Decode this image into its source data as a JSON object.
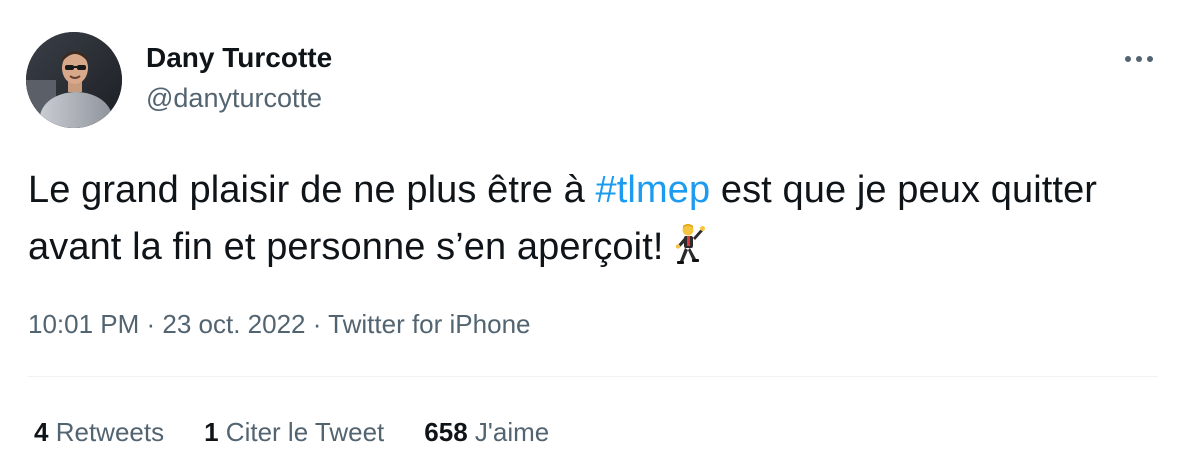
{
  "author": {
    "display_name": "Dany Turcotte",
    "handle": "@danyturcotte"
  },
  "tweet": {
    "text_before": "Le grand plaisir de ne plus être à ",
    "hashtag": "#tlmep",
    "text_after": " est que je peux quitter avant la fin et personne s’en aperçoit!",
    "emoji_icon": "man-dancing-icon"
  },
  "meta": {
    "time": "10:01 PM",
    "separator": " · ",
    "date": "23 oct. 2022",
    "source": "Twitter for iPhone"
  },
  "stats": {
    "retweets_count": "4",
    "retweets_label": "Retweets",
    "quotes_count": "1",
    "quotes_label": "Citer le Tweet",
    "likes_count": "658",
    "likes_label": "J'aime"
  },
  "colors": {
    "text": "#0f1419",
    "secondary": "#536471",
    "accent": "#1d9bf0",
    "divider": "#eff3f4"
  },
  "icons": {
    "more": "more-horizontal-icon",
    "avatar": "avatar-photo"
  }
}
